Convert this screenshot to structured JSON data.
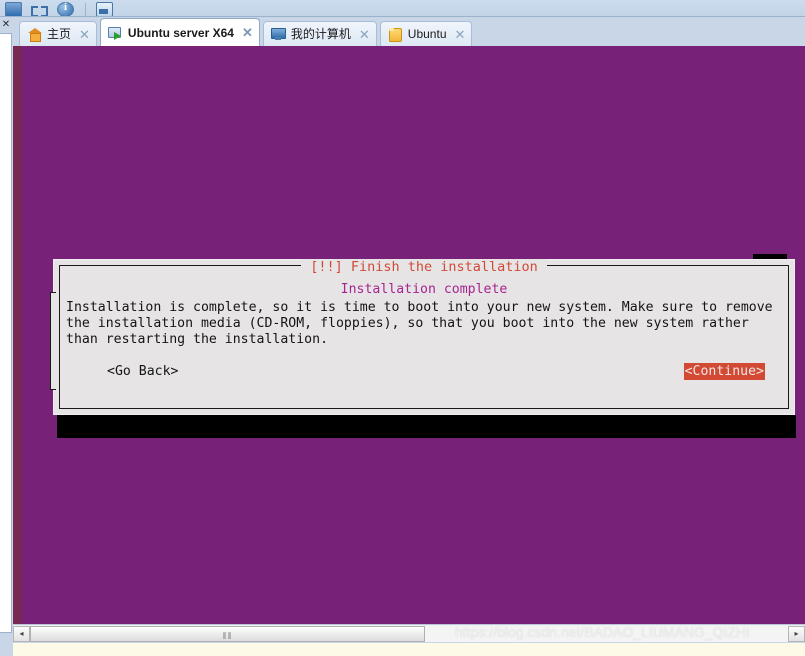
{
  "toolbar": {
    "icons": [
      "display-icon",
      "fit-window-icon",
      "info-icon",
      "window-icon"
    ],
    "separator": "|"
  },
  "left_dock": {
    "close_label": "✕"
  },
  "tabs": [
    {
      "label": "主页",
      "icon": "home-icon",
      "active": false,
      "close": "✕"
    },
    {
      "label": "Ubuntu server X64",
      "icon": "vm-play-icon",
      "active": true,
      "close": "✕"
    },
    {
      "label": "我的计算机",
      "icon": "monitor-icon",
      "active": false,
      "close": "✕"
    },
    {
      "label": "Ubuntu",
      "icon": "folder-icon",
      "active": false,
      "close": "✕"
    }
  ],
  "installer": {
    "title": "[!!] Finish the installation",
    "subheading": "Installation complete",
    "paragraph_lines": [
      "Installation is complete, so it is time to boot into your new system. Make sure to remove",
      "the installation media (CD-ROM, floppies), so that you boot into the new system rather",
      "than restarting the installation."
    ],
    "go_back_label": "<Go Back>",
    "continue_label": "<Continue>",
    "colors": {
      "background": "#772278",
      "dialog_bg": "#e7e4e6",
      "title_red": "#d04a38",
      "subheading_purple": "#a6258f",
      "continue_bg": "#d34a34",
      "continue_fg": "#f0e6e6",
      "body_text": "#141414"
    }
  },
  "scrollbar": {
    "left_arrow": "◂",
    "right_arrow": "▸",
    "grip": "⫴⫴"
  },
  "watermark": {
    "text": "https://blog.csdn.net/BADAO_LIUMANG_QIZHI"
  }
}
